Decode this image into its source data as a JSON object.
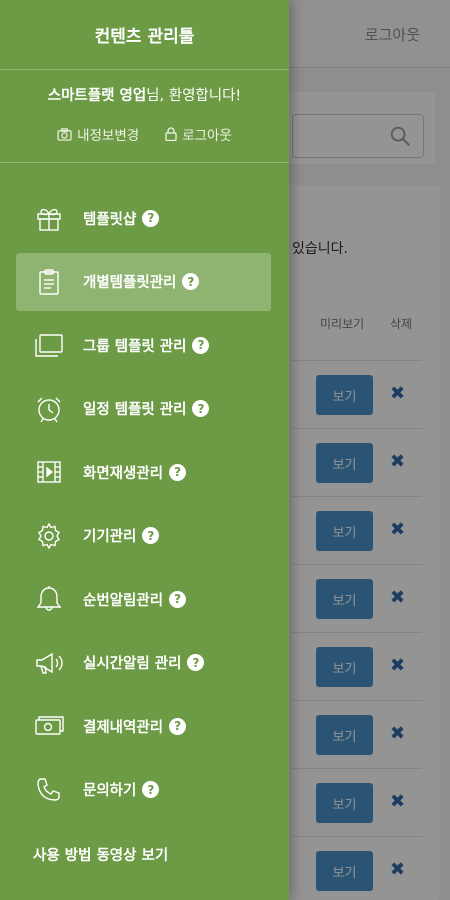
{
  "background": {
    "logout": "로그아웃",
    "notice": "있습니다.",
    "col_preview": "미리보기",
    "col_delete": "삭제",
    "view_label": "보기",
    "delete_symbol": "✖",
    "rows": 8
  },
  "drawer": {
    "title": "컨텐츠 관리툴",
    "welcome_name": "스마트플랫 영업",
    "welcome_suffix": "님, 환영합니다!",
    "edit_info": "내정보변경",
    "logout": "로그아웃",
    "help_symbol": "?",
    "menu": [
      {
        "label": "템플릿샵",
        "icon": "gift-icon",
        "active": false
      },
      {
        "label": "개별템플릿관리",
        "icon": "clipboard-icon",
        "active": true
      },
      {
        "label": "그룹 템플릿 관리",
        "icon": "windows-icon",
        "active": false
      },
      {
        "label": "일정 템플릿 관리",
        "icon": "alarm-clock-icon",
        "active": false
      },
      {
        "label": "화면재생관리",
        "icon": "film-icon",
        "active": false
      },
      {
        "label": "기기관리",
        "icon": "gear-icon",
        "active": false
      },
      {
        "label": "순번알림관리",
        "icon": "bell-icon",
        "active": false
      },
      {
        "label": "실시간알림 관리",
        "icon": "megaphone-icon",
        "active": false
      },
      {
        "label": "결제내역관리",
        "icon": "money-icon",
        "active": false
      },
      {
        "label": "문의하기",
        "icon": "phone-icon",
        "active": false
      }
    ],
    "video_link": "사용 방법 동영상 보기"
  }
}
